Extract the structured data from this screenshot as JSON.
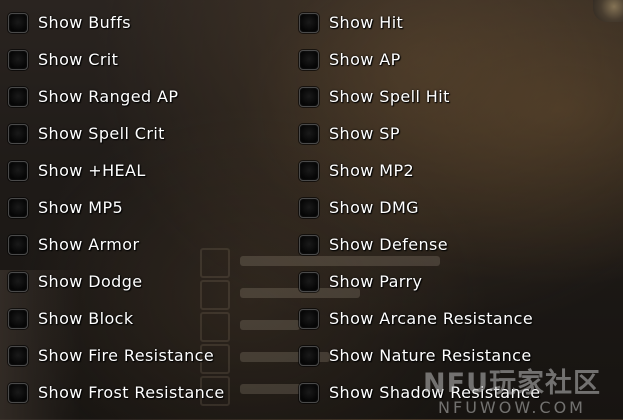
{
  "options_left": [
    {
      "label": "Show Buffs",
      "checked": false
    },
    {
      "label": "Show Crit",
      "checked": false
    },
    {
      "label": "Show Ranged AP",
      "checked": false
    },
    {
      "label": "Show Spell Crit",
      "checked": false
    },
    {
      "label": "Show +HEAL",
      "checked": false
    },
    {
      "label": "Show MP5",
      "checked": false
    },
    {
      "label": "Show Armor",
      "checked": false
    },
    {
      "label": "Show Dodge",
      "checked": false
    },
    {
      "label": "Show Block",
      "checked": false
    },
    {
      "label": "Show Fire Resistance",
      "checked": false
    },
    {
      "label": "Show Frost Resistance",
      "checked": false
    }
  ],
  "options_right": [
    {
      "label": "Show Hit",
      "checked": false
    },
    {
      "label": "Show AP",
      "checked": false
    },
    {
      "label": "Show Spell Hit",
      "checked": false
    },
    {
      "label": "Show SP",
      "checked": false
    },
    {
      "label": "Show MP2",
      "checked": false
    },
    {
      "label": "Show DMG",
      "checked": false
    },
    {
      "label": "Show Defense",
      "checked": false
    },
    {
      "label": "Show Parry",
      "checked": false
    },
    {
      "label": "Show Arcane Resistance",
      "checked": false
    },
    {
      "label": "Show Nature Resistance",
      "checked": false
    },
    {
      "label": "Show Shadow Resistance",
      "checked": false
    }
  ],
  "watermark": {
    "top": "NFU玩家社区",
    "bottom": "NFUWOW.COM"
  },
  "colors": {
    "label_text": "#ffffff",
    "checkbox_fill": "#0a0a0a",
    "background": "#1e1a17"
  }
}
